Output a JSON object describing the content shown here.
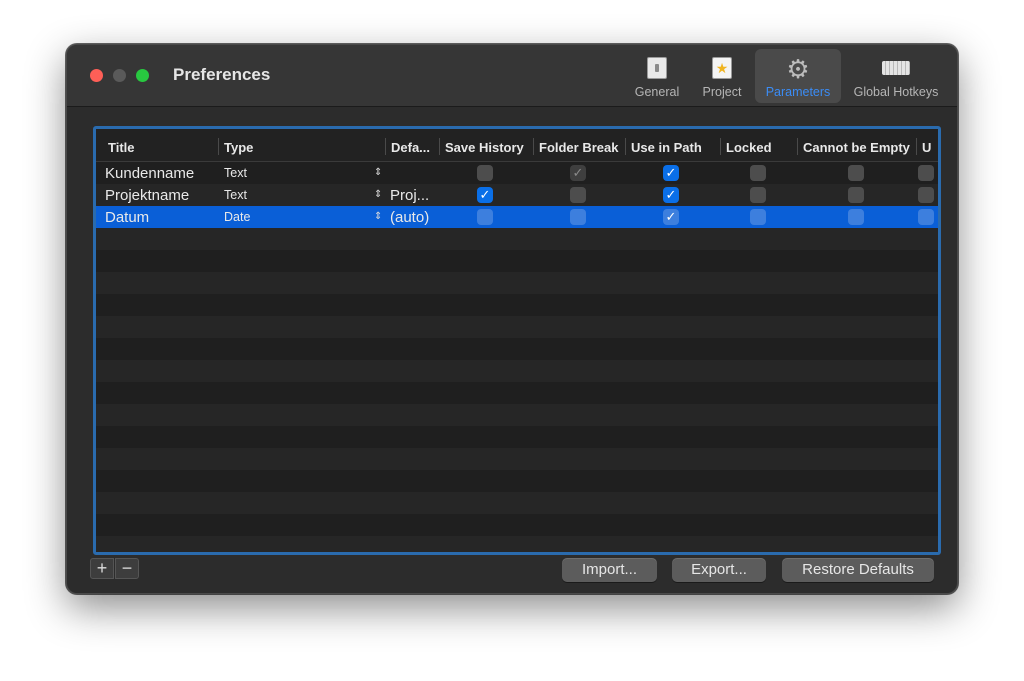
{
  "window": {
    "title": "Preferences"
  },
  "toolbar": {
    "items": [
      {
        "label": "General",
        "icon": "switch-icon"
      },
      {
        "label": "Project",
        "icon": "star-document-icon"
      },
      {
        "label": "Parameters",
        "icon": "gear-icon",
        "active": true
      },
      {
        "label": "Global Hotkeys",
        "icon": "keyboard-icon"
      }
    ]
  },
  "table": {
    "columns": [
      "Title",
      "Type",
      "Defa...",
      "Save History",
      "Folder Break",
      "Use in Path",
      "Locked",
      "Cannot be Empty",
      "U"
    ],
    "rows": [
      {
        "title": "Kundenname",
        "type": "Text",
        "default": "",
        "save_history": false,
        "folder_break": true,
        "folder_break_disabled": true,
        "use_in_path": true,
        "locked": false,
        "cannot_be_empty": false,
        "u": false,
        "selected": false
      },
      {
        "title": "Projektname",
        "type": "Text",
        "default": "Proj...",
        "save_history": true,
        "folder_break": false,
        "use_in_path": true,
        "locked": false,
        "cannot_be_empty": false,
        "u": false,
        "selected": false
      },
      {
        "title": "Datum",
        "type": "Date",
        "default": "(auto)",
        "save_history": false,
        "folder_break": false,
        "use_in_path": true,
        "locked": false,
        "cannot_be_empty": false,
        "u": false,
        "selected": true
      }
    ],
    "check_mark": "✓",
    "stepper_glyph": "⌃⌄"
  },
  "footer": {
    "add_label": "+",
    "remove_label": "−",
    "import_label": "Import...",
    "export_label": "Export...",
    "restore_label": "Restore Defaults"
  },
  "colors": {
    "accent": "#0a5fd7",
    "table_border": "#2a6bae",
    "close": "#fe5f57",
    "zoom": "#28c840"
  }
}
